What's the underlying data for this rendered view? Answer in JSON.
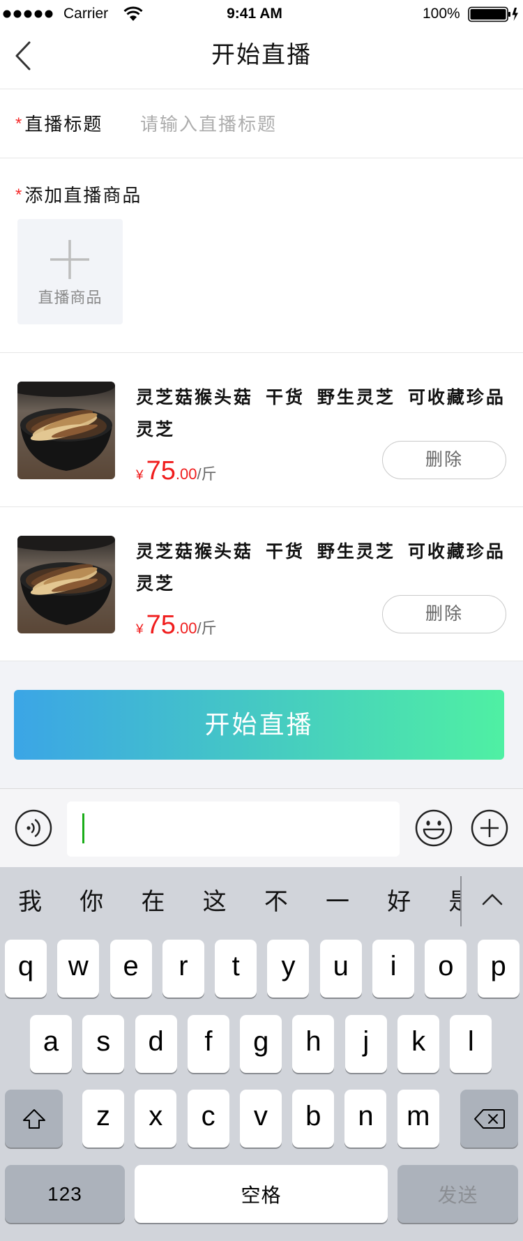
{
  "status_bar": {
    "signal_icon": "signal-strength-icon",
    "carrier": "Carrier",
    "wifi_icon": "wifi-icon",
    "time": "9:41 AM",
    "battery_percent": "100%",
    "battery_icon": "battery-charging-icon"
  },
  "nav": {
    "back_icon": "chevron-left-icon",
    "title": "开始直播"
  },
  "form": {
    "title_field": {
      "required_mark": "*",
      "label": "直播标题",
      "placeholder": "请输入直播标题",
      "value": ""
    },
    "products_section": {
      "required_mark": "*",
      "label": "添加直播商品",
      "add_icon": "plus-icon",
      "add_label": "直播商品"
    }
  },
  "products": [
    {
      "title": "灵芝菇猴头菇 干货 野生灵芝 可收藏珍品灵芝",
      "currency": "¥",
      "price_integer": "75",
      "price_decimal": ".00",
      "unit": "/斤",
      "delete_label": "删除"
    },
    {
      "title": "灵芝菇猴头菇 干货 野生灵芝 可收藏珍品灵芝",
      "currency": "¥",
      "price_integer": "75",
      "price_decimal": ".00",
      "unit": "/斤",
      "delete_label": "删除"
    }
  ],
  "start_button": {
    "label": "开始直播"
  },
  "chat_input": {
    "value": "",
    "voice_icon": "voice-input-icon",
    "emoji_icon": "emoji-icon",
    "more_icon": "plus-circle-icon"
  },
  "keyboard": {
    "candidates": [
      "我",
      "你",
      "在",
      "这",
      "不",
      "一",
      "好",
      "是"
    ],
    "collapse_icon": "chevron-up-icon",
    "rows": [
      [
        "q",
        "w",
        "e",
        "r",
        "t",
        "y",
        "u",
        "i",
        "o",
        "p"
      ],
      [
        "a",
        "s",
        "d",
        "f",
        "g",
        "h",
        "j",
        "k",
        "l"
      ],
      [
        "z",
        "x",
        "c",
        "v",
        "b",
        "n",
        "m"
      ]
    ],
    "shift_icon": "shift-icon",
    "backspace_icon": "backspace-icon",
    "numbers_key": "123",
    "space_key": "空格",
    "send_key": "发送"
  },
  "colors": {
    "required_mark": "#f52a2a",
    "price": "#f01d1d",
    "start_button_gradient_start": "#3ba5e6",
    "start_button_gradient_end": "#4ff0a3",
    "cursor": "#1aad19",
    "keyboard_background": "#d1d4da"
  }
}
